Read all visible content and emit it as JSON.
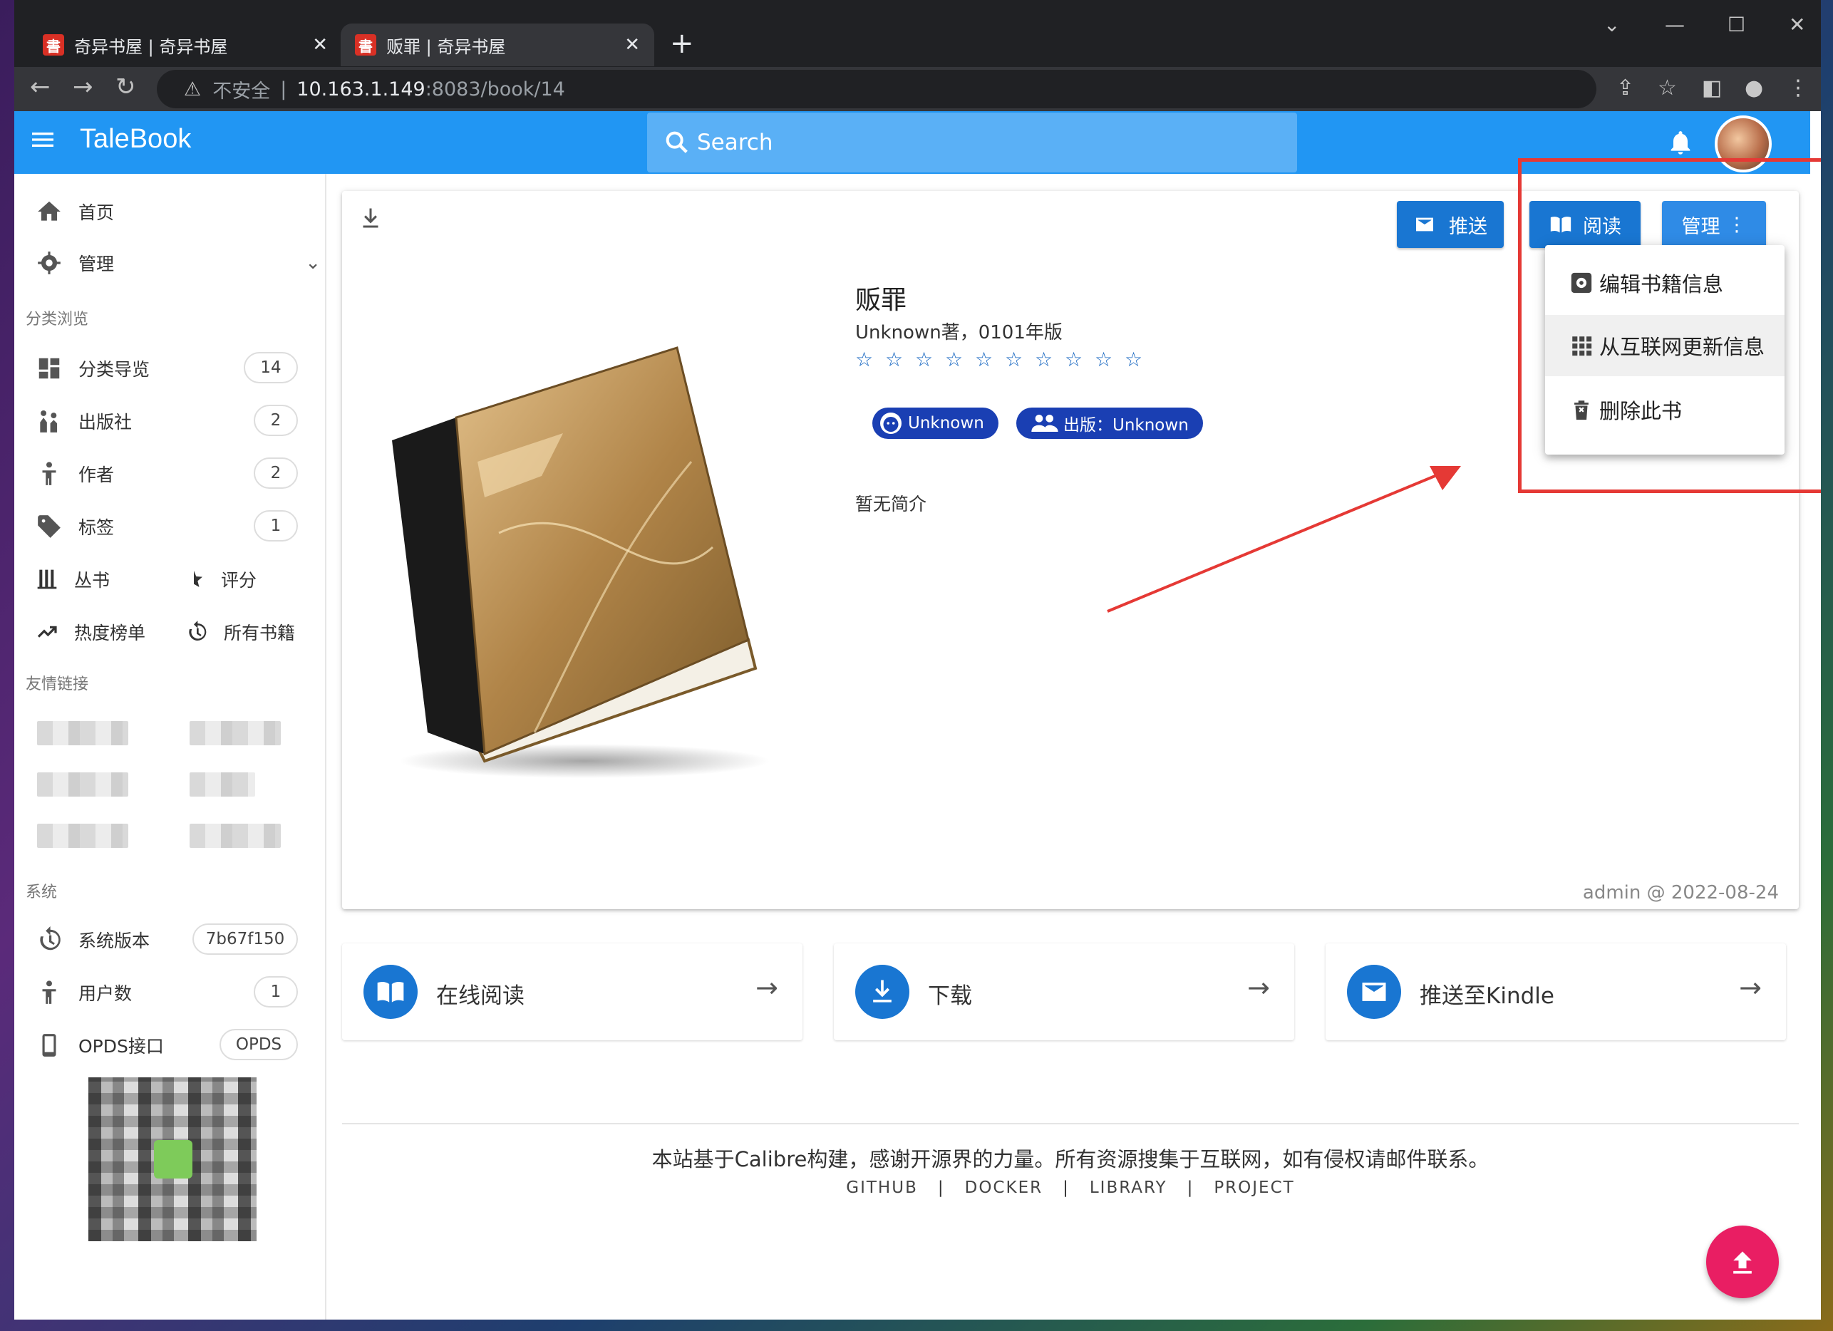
{
  "browser": {
    "tabs": [
      {
        "title": "奇异书屋 | 奇异书屋",
        "favicon": "書"
      },
      {
        "title": "贩罪 | 奇异书屋",
        "favicon": "書"
      }
    ],
    "address": {
      "insecure_label": "不安全",
      "host": "10.163.1.149",
      "rest": ":8083/book/14"
    }
  },
  "appbar": {
    "brand": "TaleBook",
    "search_placeholder": "Search"
  },
  "sidebar": {
    "home": "首页",
    "manage": "管理",
    "section_browse": "分类浏览",
    "nav": [
      {
        "label": "分类导览",
        "count": "14",
        "icon": "dashboard-icon"
      },
      {
        "label": "出版社",
        "count": "2",
        "icon": "publisher-icon"
      },
      {
        "label": "作者",
        "count": "2",
        "icon": "author-icon"
      },
      {
        "label": "标签",
        "count": "1",
        "icon": "tag-icon"
      }
    ],
    "series": "丛书",
    "rating": "评分",
    "hot": "热度榜单",
    "all_books": "所有书籍",
    "section_links": "友情链接",
    "section_system": "系统",
    "system": [
      {
        "label": "系统版本",
        "value": "7b67f150"
      },
      {
        "label": "用户数",
        "value": "1"
      },
      {
        "label": "OPDS接口",
        "value": "OPDS"
      }
    ]
  },
  "book": {
    "title": "贩罪",
    "author_line": "Unknown著，0101年版",
    "rating_stars": "☆ ☆ ☆ ☆ ☆ ☆ ☆ ☆ ☆ ☆",
    "chip_author": "Unknown",
    "chip_publisher": "出版：Unknown",
    "summary": "暂无简介",
    "uploader": "admin @ 2022-08-24"
  },
  "buttons": {
    "push": "推送",
    "read": "阅读",
    "manage": "管理"
  },
  "manage_menu": [
    "编辑书籍信息",
    "从互联网更新信息",
    "删除此书"
  ],
  "actions": [
    {
      "label": "在线阅读",
      "icon": "book-open-icon"
    },
    {
      "label": "下载",
      "icon": "download-icon"
    },
    {
      "label": "推送至Kindle",
      "icon": "email-icon"
    }
  ],
  "footer": {
    "note": "本站基于Calibre构建，感谢开源界的力量。所有资源搜集于互联网，如有侵权请邮件联系。",
    "links": [
      "GITHUB",
      "DOCKER",
      "LIBRARY",
      "PROJECT"
    ]
  },
  "colors": {
    "primary": "#2196f3",
    "button": "#1976d2",
    "chip": "#1a3fb3",
    "fab": "#e91e63",
    "annotation": "#e53935"
  }
}
